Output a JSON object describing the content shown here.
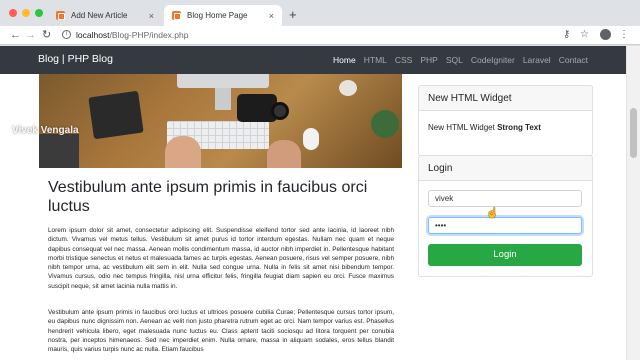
{
  "browser": {
    "tabs": [
      {
        "title": "Add New Article",
        "close": "×",
        "active": false
      },
      {
        "title": "Blog Home Page",
        "close": "×",
        "active": true
      }
    ],
    "new_tab": "+",
    "back": "←",
    "forward": "→",
    "reload": "↻",
    "info": "i",
    "url_host": "localhost",
    "url_path": "/Blog-PHP/index.php",
    "key_icon": "⚷",
    "star_icon": "☆",
    "menu_icon": "⋮"
  },
  "site": {
    "brand": "Blog | PHP Blog",
    "nav": [
      "Home",
      "HTML",
      "CSS",
      "PHP",
      "SQL",
      "CodeIgniter",
      "Laravel",
      "Contact"
    ],
    "active_nav": "Home"
  },
  "watermark": "Vivek Vengala",
  "post": {
    "title": "Vestibulum ante ipsum primis in faucibus orci luctus",
    "paragraphs": [
      "Lorem ipsum dolor sit amet, consectetur adipiscing elit. Suspendisse eleifend tortor sed ante lacinia, id laoreet nibh dictum. Vivamus vel metus tellus. Vestibulum sit amet purus id tortor interdum egestas. Nullam nec quam et neque dapibus consequat vel nec massa. Aenean mollis condimentum massa, id auctor nibh imperdiet in. Pellentesque habitant morbi tristique senectus et netus et malesuada fames ac turpis egestas. Aenean posuere, risus vel semper posuere, nibh nibh tempor urna, ac vestibulum elit sem in elit. Nulla sed congue urna. Nulla in felis sit amet nisi bibendum tempor. Vivamus cursus, odio nec tempus fringilla, nisl urna efficitur felis, fringilla feugiat diam sapien eu orci. Fusce maximus suscipit neque, sit amet lacinia nulla mattis in.",
      "Vestibulum ante ipsum primis in faucibus orci luctus et ultrices posuere cubilia Curae; Pellentesque cursus tortor ipsum, eu dapibus nunc dignissim non. Aenean ac velit non justo pharetra rutrum eget ac orci. Nam tempor varius est. Phasellus hendrerit vehicula libero, eget malesuada nunc luctus eu. Class aptent taciti sociosqu ad litora torquent per conubia nostra, per inceptos himenaeos. Sed nec imperdiet enim. Nulla ornare, massa in aliquam sodales, eros tellus blandit mauris, quis varius turpis nunc ac nulla. Etiam faucibus"
    ]
  },
  "sidebar": {
    "widget": {
      "title": "New HTML Widget",
      "text": "New HTML Widget",
      "strong": "Strong Text"
    },
    "login": {
      "title": "Login",
      "username_value": "vivek",
      "password_value": "••••",
      "button": "Login"
    }
  },
  "colors": {
    "navbar": "#343a40",
    "button": "#28a745",
    "favicon": "#f4742a",
    "focus": "#80bdff"
  }
}
